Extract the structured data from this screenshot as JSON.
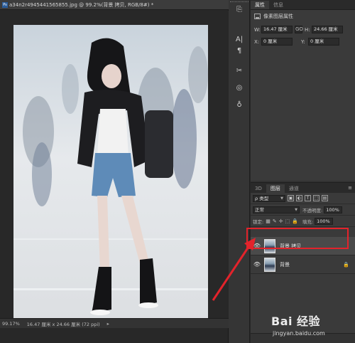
{
  "document": {
    "badge": "Ps",
    "title": "a34n2r4945441565855.jpg @ 99.2%(背景 拷贝, RGB/8#) *",
    "status_zoom": "99.17%",
    "status_info": "16.47 厘米 x 24.66 厘米 (72 ppi)",
    "status_arrow": "▸"
  },
  "tools": [
    {
      "name": "history-icon",
      "glyph": "⎘"
    },
    {
      "name": "character-icon",
      "glyph": "A|"
    },
    {
      "name": "paragraph-icon",
      "glyph": "¶"
    },
    {
      "name": "scissors-icon",
      "glyph": "✂"
    },
    {
      "name": "paths-icon",
      "glyph": "◎"
    },
    {
      "name": "lightbulb-icon",
      "glyph": "♁"
    }
  ],
  "properties": {
    "tabs": [
      "属性",
      "信息"
    ],
    "heading": "像素图层属性",
    "w_label": "W:",
    "w_value": "16.47 厘米",
    "link_glyph": "GO",
    "h_label": "H:",
    "h_value": "24.66 厘米",
    "x_label": "X:",
    "x_value": "0 厘米",
    "y_label": "Y:",
    "y_value": "0 厘米"
  },
  "layers_panel": {
    "tabs": [
      "3D",
      "图层",
      "通道"
    ],
    "menu": "≡",
    "filter_kind": "ρ 类型",
    "filter_icons": [
      "▣",
      "◐",
      "T",
      "⬚",
      "▤"
    ],
    "blend_mode": "正常",
    "opacity_label": "不透明度:",
    "opacity_value": "100%",
    "lock_label": "锁定:",
    "lock_icons": [
      "▦",
      "✎",
      "✛",
      "⬚",
      "🔒"
    ],
    "fill_label": "填充:",
    "fill_value": "100%",
    "layers": [
      {
        "name": "背景 拷贝",
        "selected": true,
        "locked": false
      },
      {
        "name": "背景",
        "selected": false,
        "locked": true
      }
    ]
  },
  "watermark": {
    "text": "Bai 经验",
    "url": "jingyan.baidu.com"
  },
  "colors": {
    "highlight": "#e3232b",
    "arrow": "#e3232b"
  }
}
